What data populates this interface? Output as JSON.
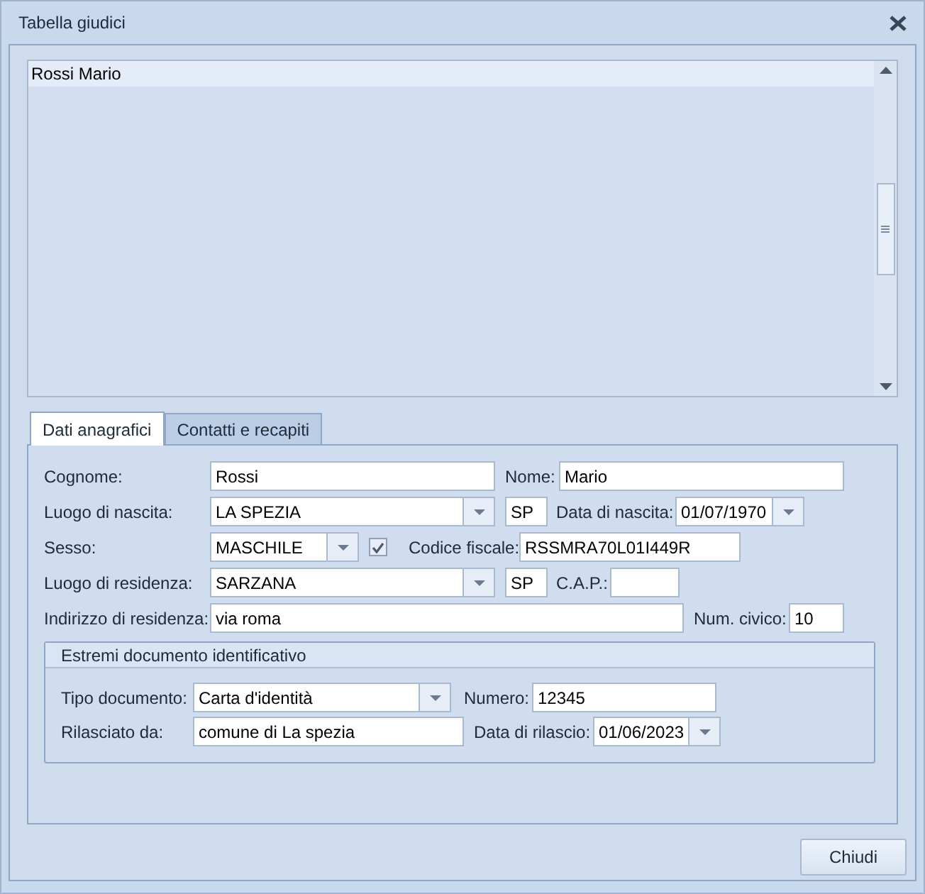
{
  "window": {
    "title": "Tabella giudici"
  },
  "list": {
    "items": [
      {
        "text": "Rossi Mario",
        "selected": true
      }
    ]
  },
  "tabs": [
    {
      "label": "Dati anagrafici",
      "selected": true
    },
    {
      "label": "Contatti e recapiti",
      "selected": false
    }
  ],
  "form": {
    "cognome": {
      "label": "Cognome:",
      "value": "Rossi"
    },
    "nome": {
      "label": "Nome:",
      "value": "Mario"
    },
    "luogo_nascita": {
      "label": "Luogo di nascita:",
      "value": "LA SPEZIA"
    },
    "provincia_nascita": {
      "value": "SP"
    },
    "data_nascita": {
      "label": "Data di nascita:",
      "value": "01/07/1970"
    },
    "sesso": {
      "label": "Sesso:",
      "value": "MASCHILE"
    },
    "codice_fiscale_check": {
      "checked": true
    },
    "codice_fiscale": {
      "label": "Codice fiscale:",
      "value": "RSSMRA70L01I449R"
    },
    "luogo_residenza": {
      "label": "Luogo di residenza:",
      "value": "SARZANA"
    },
    "provincia_residenza": {
      "value": "SP"
    },
    "cap": {
      "label": "C.A.P.:"
    },
    "indirizzo": {
      "label": "Indirizzo di residenza:",
      "value": "via roma"
    },
    "civico": {
      "label": "Num. civico:",
      "value": "10"
    }
  },
  "document": {
    "title": "Estremi documento identificativo",
    "tipo": {
      "label": "Tipo documento:",
      "value": "Carta d'identità"
    },
    "numero": {
      "label": "Numero:",
      "value": "12345"
    },
    "rilasciato": {
      "label": "Rilasciato da:",
      "value": "comune di La spezia"
    },
    "data_rilascio": {
      "label": "Data di rilascio:",
      "value": "01/06/2023"
    }
  },
  "buttons": [
    {
      "label": "Chiudi"
    }
  ]
}
